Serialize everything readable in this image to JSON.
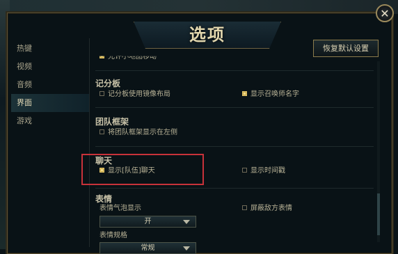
{
  "title": "选项",
  "close_label": "✕",
  "sidebar": {
    "items": [
      {
        "label": "热键",
        "active": false
      },
      {
        "label": "视频",
        "active": false
      },
      {
        "label": "音频",
        "active": false
      },
      {
        "label": "界面",
        "active": true
      },
      {
        "label": "游戏",
        "active": false
      }
    ]
  },
  "reset_label": "恢复默认设置",
  "cut_option_label": "允许小地图移动",
  "sections": {
    "scoreboard": {
      "title": "记分板",
      "options": [
        {
          "label": "记分板使用镜像布局",
          "checked": false
        },
        {
          "label": "显示召唤师名字",
          "checked": true
        }
      ]
    },
    "team_frames": {
      "title": "团队框架",
      "options": [
        {
          "label": "将团队框架显示在左侧",
          "checked": false
        }
      ]
    },
    "chat": {
      "title": "聊天",
      "options": [
        {
          "label": "显示[队伍]聊天",
          "checked": true
        },
        {
          "label": "显示时间戳",
          "checked": false
        }
      ]
    },
    "emotes": {
      "title": "表情",
      "bubble_label": "表情气泡显示",
      "bubble_value": "开",
      "hide_enemy_label": "屏蔽敌方表情",
      "hide_enemy_checked": false,
      "size_label": "表情规格",
      "size_value": "常规"
    }
  },
  "colors": {
    "accent_gold": "#c7a84a",
    "highlight_red": "#c8323a"
  }
}
